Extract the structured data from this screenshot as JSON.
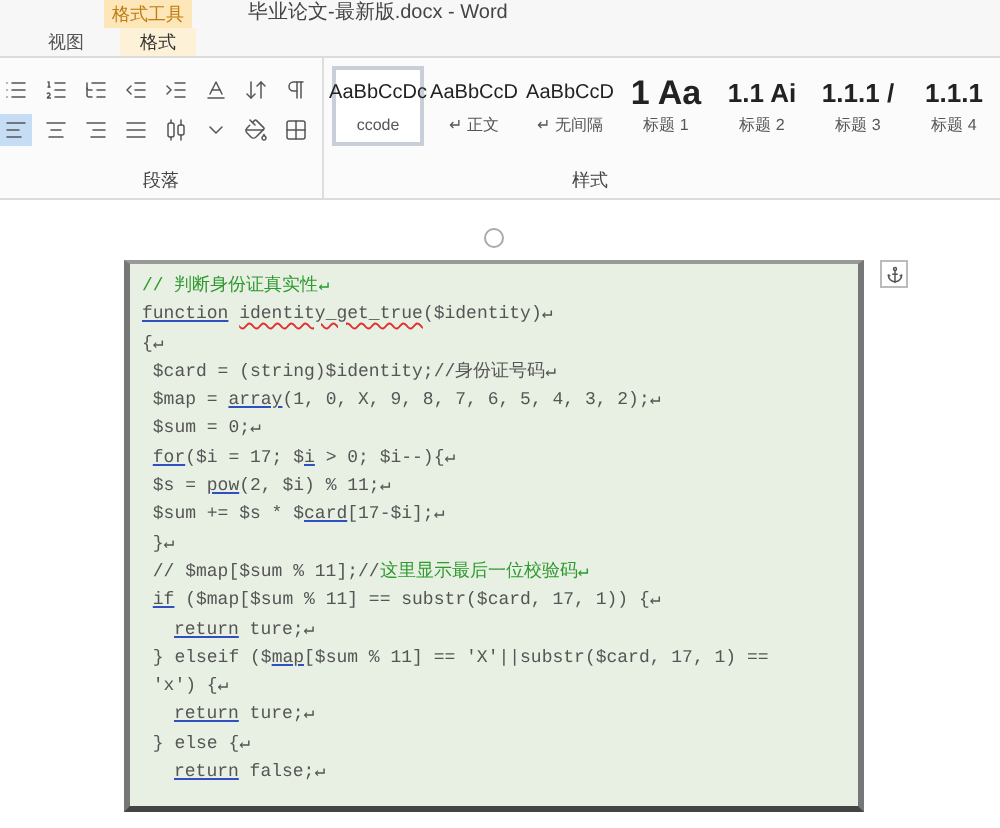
{
  "window": {
    "context_tab_group": "格式工具",
    "title": "毕业论文-最新版.docx - Word"
  },
  "tabs": [
    {
      "label": "视图",
      "selected": false
    },
    {
      "label": "格式",
      "selected": true
    }
  ],
  "paragraph_group": {
    "label": "段落",
    "alignment_buttons": [
      {
        "kind": "left",
        "selected": true
      },
      {
        "kind": "center",
        "selected": false
      },
      {
        "kind": "right",
        "selected": false
      },
      {
        "kind": "justify",
        "selected": false
      },
      {
        "kind": "distributed",
        "selected": false
      }
    ]
  },
  "styles_group": {
    "label": "样式",
    "items": [
      {
        "preview": "AaBbCcDc",
        "label": "ccode",
        "selected": true,
        "kind": "text"
      },
      {
        "preview": "AaBbCcD",
        "label": "↵ 正文",
        "selected": false,
        "kind": "text"
      },
      {
        "preview": "AaBbCcD",
        "label": "↵ 无间隔",
        "selected": false,
        "kind": "text"
      },
      {
        "preview": "1 Aa",
        "label": "标题 1",
        "selected": false,
        "kind": "heading"
      },
      {
        "preview": "1.1 Ai",
        "label": "标题 2",
        "selected": false,
        "kind": "subheading"
      },
      {
        "preview": "1.1.1 /",
        "label": "标题 3",
        "selected": false,
        "kind": "subheading"
      },
      {
        "preview": "1.1.1",
        "label": "标题 4",
        "selected": false,
        "kind": "subheading"
      }
    ]
  },
  "code_box": {
    "lines": [
      {
        "kind": "flush",
        "segments": [
          {
            "text": "// 判断身份证真实性↵",
            "kind": "comment"
          }
        ]
      },
      {
        "kind": "flush",
        "segments": [
          {
            "text": "function",
            "kind": "grammar"
          },
          {
            "text": "identity_get_true",
            "kind": "spelling",
            "spaced": true
          },
          {
            "text": "($identity)↵",
            "kind": "plain"
          }
        ]
      },
      {
        "kind": "flush",
        "segments": [
          {
            "text": "{↵",
            "kind": "plain"
          }
        ]
      },
      {
        "kind": "indented",
        "segments": [
          {
            "text": "$card = (string)$identity;//身份证号码↵",
            "kind": "plain"
          }
        ]
      },
      {
        "kind": "indented",
        "segments": [
          {
            "text": "$map = ",
            "kind": "plain"
          },
          {
            "text": "array",
            "kind": "grammar"
          },
          {
            "text": "(1, 0, X, 9, 8, 7, 6, 5, 4, 3, 2);↵",
            "kind": "plain"
          }
        ]
      },
      {
        "kind": "indented",
        "segments": [
          {
            "text": "$sum = 0;↵",
            "kind": "plain"
          }
        ]
      },
      {
        "kind": "indented",
        "segments": [
          {
            "text": "for",
            "kind": "grammar"
          },
          {
            "text": "($i = 17; $",
            "kind": "plain"
          },
          {
            "text": "i",
            "kind": "grammar"
          },
          {
            "text": " > 0; $i--){↵",
            "kind": "plain"
          }
        ]
      },
      {
        "kind": "indented",
        "segments": [
          {
            "text": "$s = ",
            "kind": "plain"
          },
          {
            "text": "pow",
            "kind": "grammar"
          },
          {
            "text": "(2, $i) % 11;↵",
            "kind": "plain"
          }
        ]
      },
      {
        "kind": "indented",
        "segments": [
          {
            "text": "$sum += $s * $",
            "kind": "plain"
          },
          {
            "text": "card",
            "kind": "grammar"
          },
          {
            "text": "[17-$i];↵",
            "kind": "plain"
          }
        ]
      },
      {
        "kind": "indented",
        "segments": [
          {
            "text": "}↵",
            "kind": "plain"
          }
        ]
      },
      {
        "kind": "indented",
        "segments": [
          {
            "text": "// $map[$sum % 11];//",
            "kind": "plain"
          },
          {
            "text": "这里显示最后一位校验码↵",
            "kind": "comment"
          }
        ]
      },
      {
        "kind": "indented",
        "segments": [
          {
            "text": "if",
            "kind": "grammar"
          },
          {
            "text": " ($map[$sum % 11] == substr($card, 17, 1)) {↵",
            "kind": "plain"
          }
        ]
      },
      {
        "kind": "nested",
        "segments": [
          {
            "text": "return",
            "kind": "grammar"
          },
          {
            "text": " ture;↵",
            "kind": "plain"
          }
        ]
      },
      {
        "kind": "indented",
        "segments": [
          {
            "text": "} elseif ($",
            "kind": "plain"
          },
          {
            "text": "map",
            "kind": "grammar"
          },
          {
            "text": "[$sum % 11] == 'X'||substr($card, 17, 1) ==",
            "kind": "plain"
          }
        ]
      },
      {
        "kind": "indented",
        "segments": [
          {
            "text": "'x') {↵",
            "kind": "plain"
          }
        ]
      },
      {
        "kind": "nested",
        "segments": [
          {
            "text": "return",
            "kind": "grammar"
          },
          {
            "text": " ture;↵",
            "kind": "plain"
          }
        ]
      },
      {
        "kind": "indented",
        "segments": [
          {
            "text": "} else {↵",
            "kind": "plain"
          }
        ]
      },
      {
        "kind": "nested",
        "segments": [
          {
            "text": "return",
            "kind": "grammar"
          },
          {
            "text": " false;↵",
            "kind": "plain"
          }
        ]
      }
    ]
  }
}
